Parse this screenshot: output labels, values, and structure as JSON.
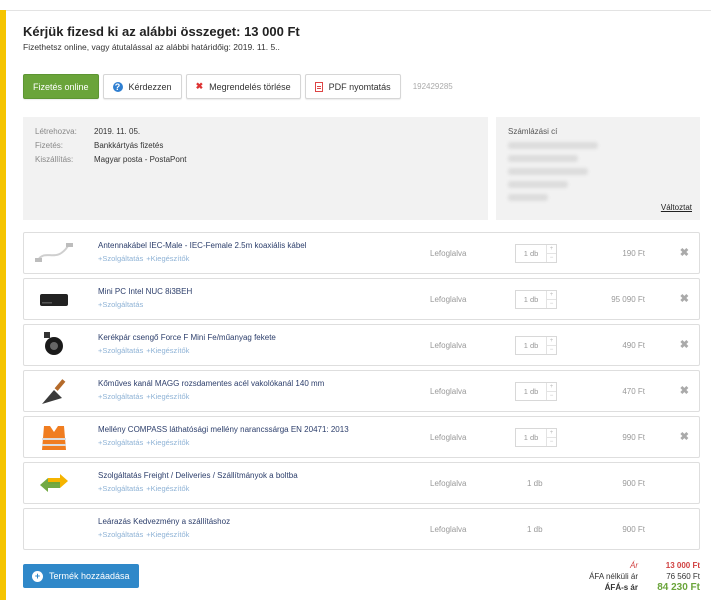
{
  "header": {
    "title": "Kérjük fizesd ki az alábbi összeget: 13 000 Ft",
    "subtitle": "Fizethetsz online, vagy átutalással az alábbi határidőig: 2019. 11. 5.."
  },
  "actions": {
    "pay_online": "Fizetés online",
    "ask": "Kérdezzen",
    "cancel_order": "Megrendelés törlése",
    "pdf_print": "PDF nyomtatás",
    "order_id": "192429285"
  },
  "info": {
    "created_label": "Létrehozva:",
    "created_value": "2019. 11. 05.",
    "payment_label": "Fizetés:",
    "payment_value": "Bankkártyás fizetés",
    "delivery_label": "Kiszállítás:",
    "delivery_value": "Magyar posta - PostaPont"
  },
  "billing": {
    "title": "Számlázási cí",
    "change_link": "Változtat"
  },
  "items": [
    {
      "name": "Antennakábel IEC-Male - IEC-Female 2.5m koaxiális kábel",
      "links": [
        "+Szolgáltatás",
        "+Kiegészítők"
      ],
      "status": "Lefoglalva",
      "qty": "1 db",
      "price": "190 Ft",
      "icon": "cable-icon",
      "editable": true
    },
    {
      "name": "Mini PC Intel NUC 8i3BEH",
      "links": [
        "+Szolgáltatás"
      ],
      "status": "Lefoglalva",
      "qty": "1 db",
      "price": "95 090 Ft",
      "icon": "mini-pc-icon",
      "editable": true
    },
    {
      "name": "Kerékpár csengő Force F Mini Fe/műanyag fekete",
      "links": [
        "+Szolgáltatás",
        "+Kiegészítők"
      ],
      "status": "Lefoglalva",
      "qty": "1 db",
      "price": "490 Ft",
      "icon": "bell-icon",
      "editable": true
    },
    {
      "name": "Kőműves kanál MAGG rozsdamentes acél vakolókanál 140 mm",
      "links": [
        "+Szolgáltatás",
        "+Kiegészítők"
      ],
      "status": "Lefoglalva",
      "qty": "1 db",
      "price": "470 Ft",
      "icon": "trowel-icon",
      "editable": true
    },
    {
      "name": "Mellény COMPASS láthatósági mellény narancssárga EN 20471: 2013",
      "links": [
        "+Szolgáltatás",
        "+Kiegészítők"
      ],
      "status": "Lefoglalva",
      "qty": "1 db",
      "price": "990 Ft",
      "icon": "vest-icon",
      "editable": true
    },
    {
      "name": "Szolgáltatás Freight / Deliveries / Szállítmányok a boltba",
      "links": [
        "+Szolgáltatás",
        "+Kiegészítők"
      ],
      "status": "Lefoglalva",
      "qty": "1 db",
      "price": "900 Ft",
      "icon": "exchange-arrows-icon",
      "editable": false
    },
    {
      "name": "Leárazás Kedvezmény a szállításhoz",
      "links": [
        "+Szolgáltatás",
        "+Kiegészítők"
      ],
      "status": "Lefoglalva",
      "qty": "1 db",
      "price": "900 Ft",
      "icon": "",
      "editable": false
    }
  ],
  "add_product": "Termék hozzáadása",
  "totals": {
    "price_label": "Ár",
    "price_value": "13 000 Ft",
    "net_label": "ÁFA nélküli ár",
    "net_value": "76 560 Ft",
    "gross_label": "ÁFÁ-s ár",
    "gross_value": "84 230 Ft"
  },
  "colors": {
    "accent_yellow": "#f5c400",
    "pay_green": "#6aa43a",
    "add_blue": "#2f88c9",
    "price_red": "#d04040"
  }
}
